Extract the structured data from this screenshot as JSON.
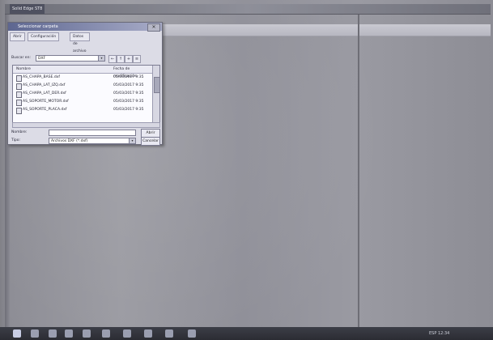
{
  "app": {
    "title": "Solid Edge ST8"
  },
  "dialog": {
    "title": "Seleccionar carpeta",
    "tabs": [
      "Abrir",
      "Configuración",
      "Datos de archivo"
    ],
    "look_in_label": "Buscar en:",
    "look_in_value": "DXF",
    "columns": {
      "name": "Nombre",
      "date": "Fecha de modificación"
    },
    "files": [
      {
        "name": "AS_CHAPA_BASE.dxf",
        "date": "05/03/2017 9:35"
      },
      {
        "name": "AS_CHAPA_LAT_IZQ.dxf",
        "date": "05/03/2017 9:35"
      },
      {
        "name": "AS_CHAPA_LAT_DER.dxf",
        "date": "05/03/2017 9:35"
      },
      {
        "name": "AS_SOPORTE_MOTOR.dxf",
        "date": "05/03/2017 9:35"
      },
      {
        "name": "AS_SOPORTE_PLACA.dxf",
        "date": "05/03/2017 9:35"
      }
    ],
    "filename_label": "Nombre:",
    "filename_value": "",
    "filetype_label": "Tipo:",
    "filetype_value": "Archivos DXF (*.dxf)",
    "open_label": "Abrir",
    "cancel_label": "Cancelar",
    "close_glyph": "✕"
  },
  "taskbar": {
    "tray_text": "ESP 12:34"
  }
}
